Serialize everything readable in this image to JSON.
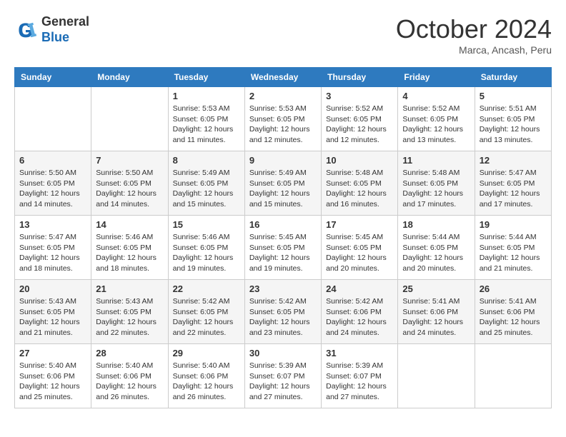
{
  "header": {
    "logo_general": "General",
    "logo_blue": "Blue",
    "month_title": "October 2024",
    "subtitle": "Marca, Ancash, Peru"
  },
  "days_of_week": [
    "Sunday",
    "Monday",
    "Tuesday",
    "Wednesday",
    "Thursday",
    "Friday",
    "Saturday"
  ],
  "weeks": [
    [
      {
        "day": "",
        "content": ""
      },
      {
        "day": "",
        "content": ""
      },
      {
        "day": "1",
        "content": "Sunrise: 5:53 AM\nSunset: 6:05 PM\nDaylight: 12 hours and 11 minutes."
      },
      {
        "day": "2",
        "content": "Sunrise: 5:53 AM\nSunset: 6:05 PM\nDaylight: 12 hours and 12 minutes."
      },
      {
        "day": "3",
        "content": "Sunrise: 5:52 AM\nSunset: 6:05 PM\nDaylight: 12 hours and 12 minutes."
      },
      {
        "day": "4",
        "content": "Sunrise: 5:52 AM\nSunset: 6:05 PM\nDaylight: 12 hours and 13 minutes."
      },
      {
        "day": "5",
        "content": "Sunrise: 5:51 AM\nSunset: 6:05 PM\nDaylight: 12 hours and 13 minutes."
      }
    ],
    [
      {
        "day": "6",
        "content": "Sunrise: 5:50 AM\nSunset: 6:05 PM\nDaylight: 12 hours and 14 minutes."
      },
      {
        "day": "7",
        "content": "Sunrise: 5:50 AM\nSunset: 6:05 PM\nDaylight: 12 hours and 14 minutes."
      },
      {
        "day": "8",
        "content": "Sunrise: 5:49 AM\nSunset: 6:05 PM\nDaylight: 12 hours and 15 minutes."
      },
      {
        "day": "9",
        "content": "Sunrise: 5:49 AM\nSunset: 6:05 PM\nDaylight: 12 hours and 15 minutes."
      },
      {
        "day": "10",
        "content": "Sunrise: 5:48 AM\nSunset: 6:05 PM\nDaylight: 12 hours and 16 minutes."
      },
      {
        "day": "11",
        "content": "Sunrise: 5:48 AM\nSunset: 6:05 PM\nDaylight: 12 hours and 17 minutes."
      },
      {
        "day": "12",
        "content": "Sunrise: 5:47 AM\nSunset: 6:05 PM\nDaylight: 12 hours and 17 minutes."
      }
    ],
    [
      {
        "day": "13",
        "content": "Sunrise: 5:47 AM\nSunset: 6:05 PM\nDaylight: 12 hours and 18 minutes."
      },
      {
        "day": "14",
        "content": "Sunrise: 5:46 AM\nSunset: 6:05 PM\nDaylight: 12 hours and 18 minutes."
      },
      {
        "day": "15",
        "content": "Sunrise: 5:46 AM\nSunset: 6:05 PM\nDaylight: 12 hours and 19 minutes."
      },
      {
        "day": "16",
        "content": "Sunrise: 5:45 AM\nSunset: 6:05 PM\nDaylight: 12 hours and 19 minutes."
      },
      {
        "day": "17",
        "content": "Sunrise: 5:45 AM\nSunset: 6:05 PM\nDaylight: 12 hours and 20 minutes."
      },
      {
        "day": "18",
        "content": "Sunrise: 5:44 AM\nSunset: 6:05 PM\nDaylight: 12 hours and 20 minutes."
      },
      {
        "day": "19",
        "content": "Sunrise: 5:44 AM\nSunset: 6:05 PM\nDaylight: 12 hours and 21 minutes."
      }
    ],
    [
      {
        "day": "20",
        "content": "Sunrise: 5:43 AM\nSunset: 6:05 PM\nDaylight: 12 hours and 21 minutes."
      },
      {
        "day": "21",
        "content": "Sunrise: 5:43 AM\nSunset: 6:05 PM\nDaylight: 12 hours and 22 minutes."
      },
      {
        "day": "22",
        "content": "Sunrise: 5:42 AM\nSunset: 6:05 PM\nDaylight: 12 hours and 22 minutes."
      },
      {
        "day": "23",
        "content": "Sunrise: 5:42 AM\nSunset: 6:05 PM\nDaylight: 12 hours and 23 minutes."
      },
      {
        "day": "24",
        "content": "Sunrise: 5:42 AM\nSunset: 6:06 PM\nDaylight: 12 hours and 24 minutes."
      },
      {
        "day": "25",
        "content": "Sunrise: 5:41 AM\nSunset: 6:06 PM\nDaylight: 12 hours and 24 minutes."
      },
      {
        "day": "26",
        "content": "Sunrise: 5:41 AM\nSunset: 6:06 PM\nDaylight: 12 hours and 25 minutes."
      }
    ],
    [
      {
        "day": "27",
        "content": "Sunrise: 5:40 AM\nSunset: 6:06 PM\nDaylight: 12 hours and 25 minutes."
      },
      {
        "day": "28",
        "content": "Sunrise: 5:40 AM\nSunset: 6:06 PM\nDaylight: 12 hours and 26 minutes."
      },
      {
        "day": "29",
        "content": "Sunrise: 5:40 AM\nSunset: 6:06 PM\nDaylight: 12 hours and 26 minutes."
      },
      {
        "day": "30",
        "content": "Sunrise: 5:39 AM\nSunset: 6:07 PM\nDaylight: 12 hours and 27 minutes."
      },
      {
        "day": "31",
        "content": "Sunrise: 5:39 AM\nSunset: 6:07 PM\nDaylight: 12 hours and 27 minutes."
      },
      {
        "day": "",
        "content": ""
      },
      {
        "day": "",
        "content": ""
      }
    ]
  ]
}
